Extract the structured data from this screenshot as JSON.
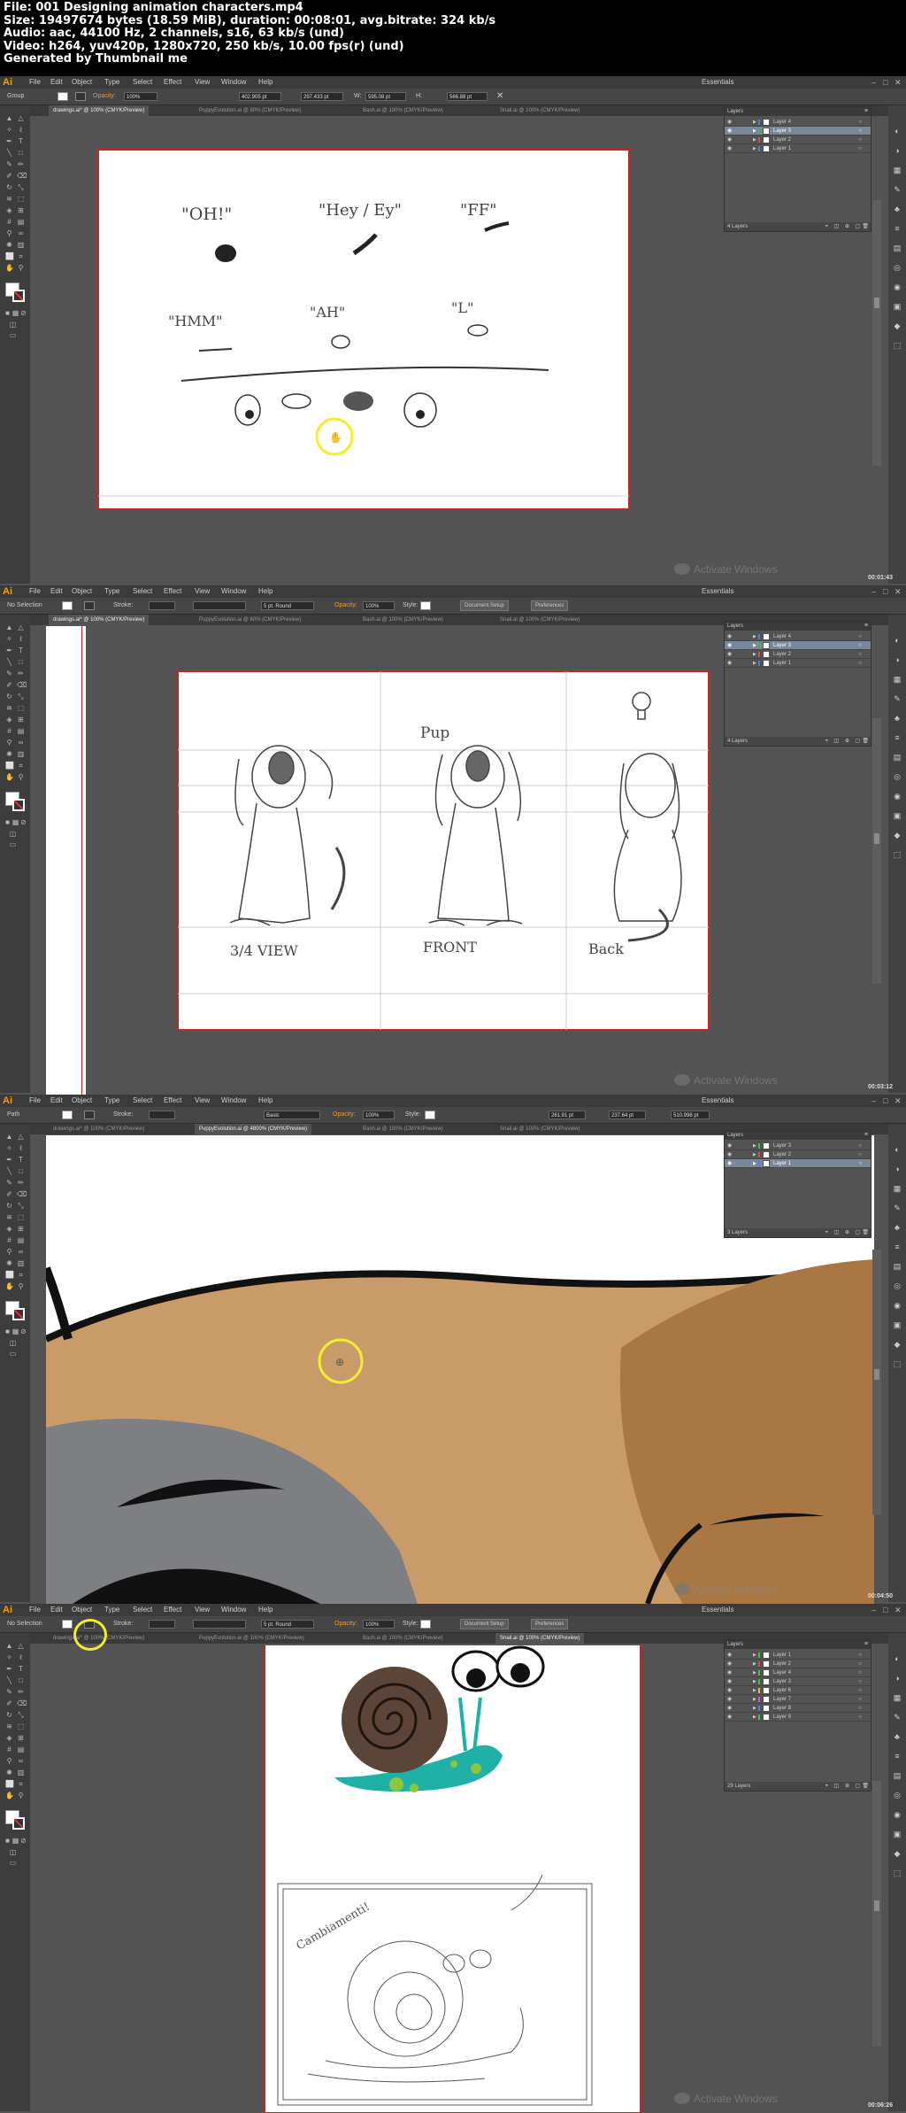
{
  "file_info": {
    "file": "File: 001 Designing animation characters.mp4",
    "size": "Size: 19497674 bytes (18.59 MiB), duration: 00:08:01, avg.bitrate: 324 kb/s",
    "audio": "Audio: aac, 44100 Hz, 2 channels, s16, 63 kb/s (und)",
    "video": "Video: h264, yuv420p, 1280x720, 250 kb/s, 10.00 fps(r) (und)",
    "generated": "Generated by Thumbnail me"
  },
  "app": {
    "logo": "Ai",
    "menu": [
      "File",
      "Edit",
      "Object",
      "Type",
      "Select",
      "Effect",
      "View",
      "Window",
      "Help"
    ],
    "workspace": "Essentials",
    "watermark": "Activate Windows",
    "colors": {
      "menubar": "#3b3b3b",
      "ctrl": "#464646",
      "workspace": "#535353",
      "accent_opacity": "#e89c2a",
      "highlight": "#f2ef2a"
    }
  },
  "frames": [
    {
      "timestamp": "00:01:43",
      "control": {
        "selection_label": "Group",
        "opacity_label": "Opacity:",
        "opacity_value": "100%",
        "x_value": "402.905 pt",
        "y_value": "297.433 pt",
        "w_label": "W:",
        "w_value": "595.08 pt",
        "h_label": "H:",
        "h_value": "566.88 pt"
      },
      "tabs": [
        "drawings.ai* @ 100% (CMYK/Preview)",
        "PuppyEvolution.ai @ 80% (CMYK/Preview)",
        "Bash.ai @ 100% (CMYK/Preview)",
        "Snail.ai @ 100% (CMYK/Preview)"
      ],
      "active_tab": 0,
      "layers": {
        "title": "Layers",
        "rows": [
          {
            "name": "Layer 4",
            "color": "#4a7bd6",
            "selected": false
          },
          {
            "name": "Layer 3",
            "color": "#3ebd3e",
            "selected": true
          },
          {
            "name": "Layer 2",
            "color": "#d94a4a",
            "selected": false
          },
          {
            "name": "Layer 1",
            "color": "#4a7bd6",
            "selected": false
          }
        ],
        "footer": "4 Layers"
      },
      "drawing": {
        "labels": [
          "\"OH!\"",
          "\"Hey / Ey\"",
          "\"FF\"",
          "\"HMM\"",
          "\"AH\"",
          "\"L\""
        ]
      }
    },
    {
      "timestamp": "00:03:12",
      "control": {
        "selection_label": "No Selection",
        "stroke_label": "Stroke:",
        "stroke_profile": "5 pt. Round",
        "opacity_label": "Opacity:",
        "opacity_value": "100%",
        "style_label": "Style:",
        "doc_setup": "Document Setup",
        "preferences": "Preferences"
      },
      "tabs": [
        "drawings.ai* @ 100% (CMYK/Preview)",
        "PuppyEvolution.ai @ 80% (CMYK/Preview)",
        "Bash.ai @ 100% (CMYK/Preview)",
        "Snail.ai @ 100% (CMYK/Preview)"
      ],
      "active_tab": 0,
      "layers": {
        "title": "Layers",
        "rows": [
          {
            "name": "Layer 4",
            "color": "#4a7bd6",
            "selected": false
          },
          {
            "name": "Layer 3",
            "color": "#3ebd3e",
            "selected": true
          },
          {
            "name": "Layer 2",
            "color": "#d94a4a",
            "selected": false
          },
          {
            "name": "Layer 1",
            "color": "#4a7bd6",
            "selected": false
          }
        ],
        "footer": "4 Layers"
      },
      "drawing": {
        "labels": [
          "Pup",
          "3/4 VIEW",
          "FRONT",
          "Back"
        ]
      }
    },
    {
      "timestamp": "00:04:50",
      "control": {
        "selection_label": "Path",
        "stroke_label": "Stroke:",
        "stroke_profile": "Basic",
        "opacity_label": "Opacity:",
        "opacity_value": "100%",
        "style_label": "Style:",
        "x_value": "261.91 pt",
        "y_value": "237.64 pt",
        "w_value": "510.998 pt"
      },
      "tabs": [
        "drawings.ai* @ 100% (CMYK/Preview)",
        "PuppyEvolution.ai @ 4800% (CMYK/Preview)",
        "Bash.ai @ 100% (CMYK/Preview)",
        "Snail.ai @ 100% (CMYK/Preview)"
      ],
      "active_tab": 1,
      "layers": {
        "title": "Layers",
        "rows": [
          {
            "name": "Layer 3",
            "color": "#3ebd3e",
            "selected": false
          },
          {
            "name": "Layer 2",
            "color": "#d94a4a",
            "selected": false
          },
          {
            "name": "Layer 1",
            "color": "#4a7bd6",
            "selected": true
          }
        ],
        "footer": "3 Layers"
      },
      "colors": {
        "fur_light": "#c99b68",
        "fur_dark": "#a97744",
        "patch": "#7d7f82",
        "outline": "#111111"
      }
    },
    {
      "timestamp": "00:06:26",
      "control": {
        "selection_label": "No Selection",
        "stroke_label": "Stroke:",
        "stroke_profile": "5 pt. Round",
        "opacity_label": "Opacity:",
        "opacity_value": "100%",
        "style_label": "Style:",
        "doc_setup": "Document Setup",
        "preferences": "Preferences"
      },
      "tabs": [
        "drawings.ai* @ 100% (CMYK/Preview)",
        "PuppyEvolution.ai @ 100% (CMYK/Preview)",
        "Bash.ai @ 100% (CMYK/Preview)",
        "Snail.ai @ 100% (CMYK/Preview)"
      ],
      "active_tab": 3,
      "layers": {
        "title": "Layers",
        "rows": [
          {
            "name": "Layer 1",
            "color": "#3ebd3e",
            "selected": false
          },
          {
            "name": "Layer 2",
            "color": "#d94a4a",
            "selected": false
          },
          {
            "name": "Layer 4",
            "color": "#3ebd3e",
            "selected": false
          },
          {
            "name": "Layer 3",
            "color": "#3ebd3e",
            "selected": false
          },
          {
            "name": "Layer 6",
            "color": "#d9c04a",
            "selected": false
          },
          {
            "name": "Layer 7",
            "color": "#d94ad9",
            "selected": false
          },
          {
            "name": "Layer 8",
            "color": "#4a7bd6",
            "selected": false
          },
          {
            "name": "Layer 9",
            "color": "#3ebd3e",
            "selected": false
          }
        ],
        "footer": "29 Layers"
      },
      "drawing": {
        "labels": [
          "Cambiamenti!"
        ]
      },
      "colors": {
        "shell": "#5a4538",
        "body": "#1fb0a6",
        "spots": "#8cc63f"
      }
    }
  ]
}
